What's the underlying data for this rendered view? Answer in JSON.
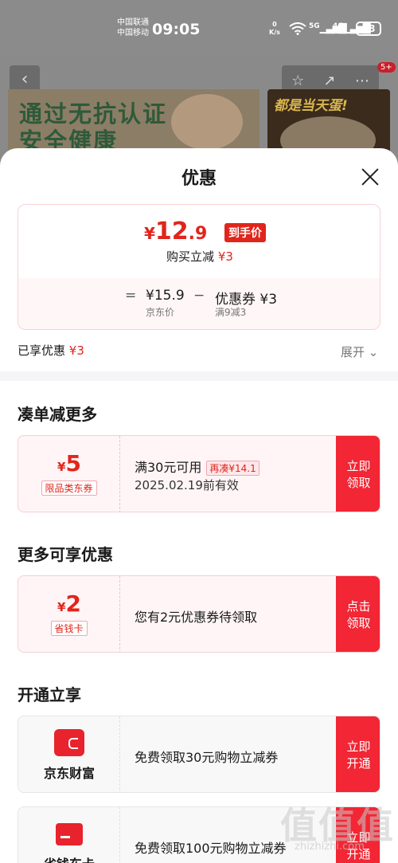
{
  "status_bar": {
    "carrier1": "中国联通",
    "carrier2": "中国移动",
    "time": "09:05",
    "net_speed_value": "0",
    "net_speed_unit": "K/s",
    "signal1": "5G",
    "signal2": "4G",
    "battery": "88"
  },
  "background": {
    "badge": "5+",
    "banner_line1": "通过无抗认证",
    "banner_line2": "安全健康",
    "side_text": "都是当天蛋!"
  },
  "sheet": {
    "title": "优惠",
    "price": {
      "yen": "¥",
      "int": "12",
      "dec": ".9",
      "tag": "到手价",
      "instant_label": "购买立减",
      "instant_amount": "¥3",
      "equals": "=",
      "base_price": "¥15.9",
      "base_label": "京东价",
      "minus": "−",
      "coupon_label": "优惠券 ¥3",
      "coupon_cond": "满9减3"
    },
    "enjoyed_label": "已享优惠",
    "enjoyed_amount": "¥3",
    "expand_label": "展开 ⌄",
    "section1": {
      "title": "凑单减更多",
      "coupon": {
        "yen": "¥",
        "amount": "5",
        "tag": "限品类东券",
        "main": "满30元可用",
        "badge": "再凑¥14.1",
        "sub": "2025.02.19前有效",
        "btn_line1": "立即",
        "btn_line2": "领取"
      }
    },
    "section2": {
      "title": "更多可享优惠",
      "coupon": {
        "yen": "¥",
        "amount": "2",
        "tag": "省钱卡",
        "main": "您有2元优惠券待领取",
        "btn_line1": "点击",
        "btn_line2": "领取"
      }
    },
    "section3": {
      "title": "开通立享",
      "items": [
        {
          "brand": "京东财富",
          "main": "免费领取30元购物立减券",
          "btn_line1": "立即",
          "btn_line2": "开通"
        },
        {
          "brand": "省钱东卡",
          "main": "免费领取100元购物立减券",
          "btn_line1": "立即",
          "btn_line2": "开通"
        }
      ]
    }
  },
  "watermark": {
    "main": "值值值",
    "sub": "zhizhizhi.com"
  },
  "colors": {
    "accent": "#e1251b",
    "button": "#f22634"
  }
}
